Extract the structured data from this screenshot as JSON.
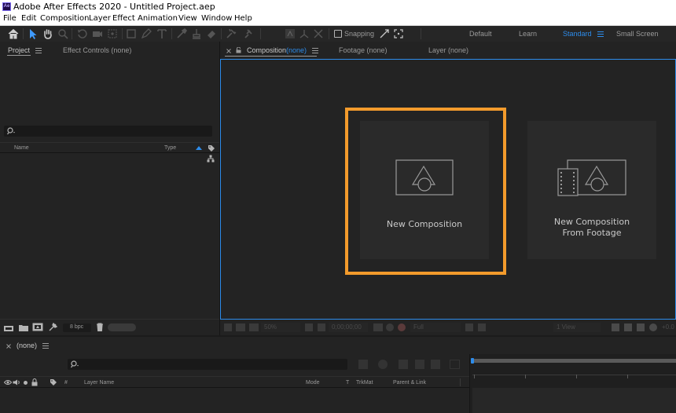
{
  "app": {
    "logo": "Ae",
    "window_title": "Adobe After Effects 2020 - Untitled Project.aep"
  },
  "menu": [
    "File",
    "Edit",
    "Composition",
    "Layer",
    "Effect",
    "Animation",
    "View",
    "Window",
    "Help"
  ],
  "toolbar": {
    "snapping_label": "Snapping",
    "snapping_checked": false,
    "workspaces": [
      "Default",
      "Learn",
      "Standard",
      "Small Screen"
    ],
    "active_workspace": "Standard"
  },
  "project_panel": {
    "tab": "Project",
    "effect_controls_tab": "Effect Controls (none)",
    "columns": {
      "name": "Name",
      "type": "Type"
    },
    "bit_depth": "8 bpc"
  },
  "viewer": {
    "tabs": {
      "composition": "Composition",
      "composition_target": "(none)",
      "footage": "Footage  (none)",
      "layer": "Layer  (none)"
    },
    "cards": {
      "new_composition": "New Composition",
      "from_footage_line1": "New Composition",
      "from_footage_line2": "From Footage"
    },
    "footer": {
      "zoom": "50%",
      "timecode": "0;00;00;00",
      "resolution": "Full",
      "view": "1 View",
      "offset": "+0.0"
    }
  },
  "timeline": {
    "tab": "(none)",
    "columns": {
      "number": "#",
      "layer_name": "Layer Name",
      "mode": "Mode",
      "t": "T",
      "trkmat": "TrkMat",
      "parent": "Parent & Link"
    }
  },
  "colors": {
    "highlight": "#f39b2c",
    "accent_blue": "#2d8ceb",
    "panel_bg": "#232323",
    "card_bg": "#2a2a2a"
  }
}
